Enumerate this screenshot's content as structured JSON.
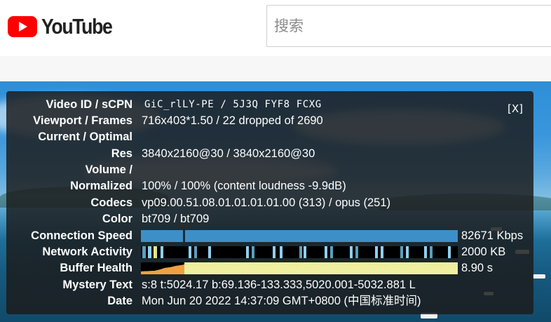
{
  "header": {
    "logo_text": "YouTube",
    "search_placeholder": "搜索"
  },
  "stats": {
    "close_label": "[X]",
    "rows": [
      {
        "label": "Video ID / sCPN",
        "value": "GiC_rlLY-PE / 5J3Q FYF8 FCXG"
      },
      {
        "label": "Viewport / Frames",
        "value": "716x403*1.50 / 22 dropped of 2690"
      },
      {
        "label": "Current / Optimal",
        "value": ""
      },
      {
        "label": "Res",
        "value": "3840x2160@30 / 3840x2160@30"
      },
      {
        "label": "Volume /",
        "value": ""
      },
      {
        "label": "Normalized",
        "value": "100% / 100% (content loudness -9.9dB)"
      },
      {
        "label": "Codecs",
        "value": "vp09.00.51.08.01.01.01.01.00 (313) / opus (251)"
      },
      {
        "label": "Color",
        "value": "bt709 / bt709"
      }
    ],
    "connection_speed": {
      "label": "Connection Speed",
      "value": "82671 Kbps"
    },
    "network_activity": {
      "label": "Network Activity",
      "value": "2000 KB"
    },
    "buffer_health": {
      "label": "Buffer Health",
      "value": "8.90 s"
    },
    "mystery_text": {
      "label": "Mystery Text",
      "value": "s:8 t:5024.17 b:69.136-133.333,5020.001-5032.881 L"
    },
    "date": {
      "label": "Date",
      "value": "Mon Jun 20 2022 14:37:09 GMT+0800 (中国标准时间)"
    },
    "colors": {
      "connection": "#3d8fc8",
      "network_light": "#8fd0f0",
      "network_mid": "#5a9fc0",
      "network_yellow": "#e4e48a",
      "buffer_fill": "#eef0a0",
      "buffer_orange": "#f0a040"
    }
  }
}
